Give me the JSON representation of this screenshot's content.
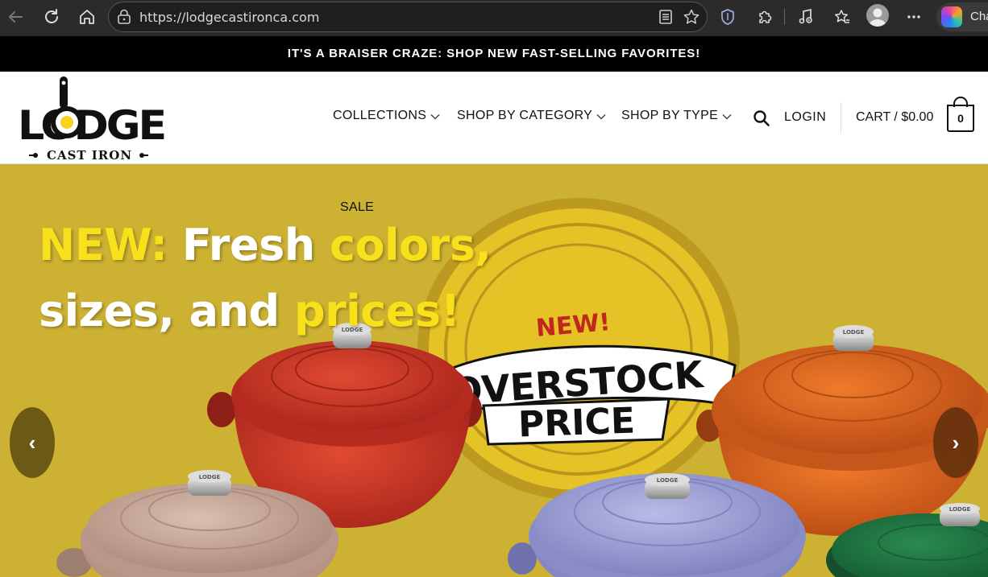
{
  "browser": {
    "url": "https://lodgecastironca.com",
    "copilot_label": "Cha"
  },
  "announcement": {
    "text": "IT'S A BRAISER CRAZE: SHOP NEW FAST-SELLING FAVORITES!"
  },
  "header": {
    "logo": {
      "brand": "LODGE",
      "tagline": "CAST IRON"
    },
    "nav": [
      {
        "label": "COLLECTIONS"
      },
      {
        "label": "SHOP BY CATEGORY"
      },
      {
        "label": "SHOP BY TYPE"
      }
    ],
    "login_label": "LOGIN",
    "cart_label": "CART / $0.00",
    "cart_count": "0"
  },
  "hero": {
    "sale_label": "SALE",
    "headline": {
      "line1": [
        {
          "text": "NEW:",
          "tone": "yellow"
        },
        {
          "text": " Fresh ",
          "tone": "white"
        },
        {
          "text": "colors,",
          "tone": "yellow"
        }
      ],
      "line2": [
        {
          "text": "sizes, and ",
          "tone": "white"
        },
        {
          "text": "prices!",
          "tone": "yellow"
        }
      ]
    },
    "badge": {
      "top": "NEW!",
      "line1": "OVERSTOCK",
      "line2": "PRICE"
    },
    "lid_knob_text": "LODGE",
    "prev_arrow": "‹",
    "next_arrow": "›"
  },
  "colors": {
    "hero_bg": "#ccb133",
    "headline_yellow": "#f8e01a",
    "announcement_bg": "#000000",
    "pot_red": "#c8372a",
    "pot_orange": "#d8641e",
    "pot_taupe": "#c9a896",
    "pot_lavender": "#9d9fd4",
    "pot_green": "#1e6b3c"
  }
}
